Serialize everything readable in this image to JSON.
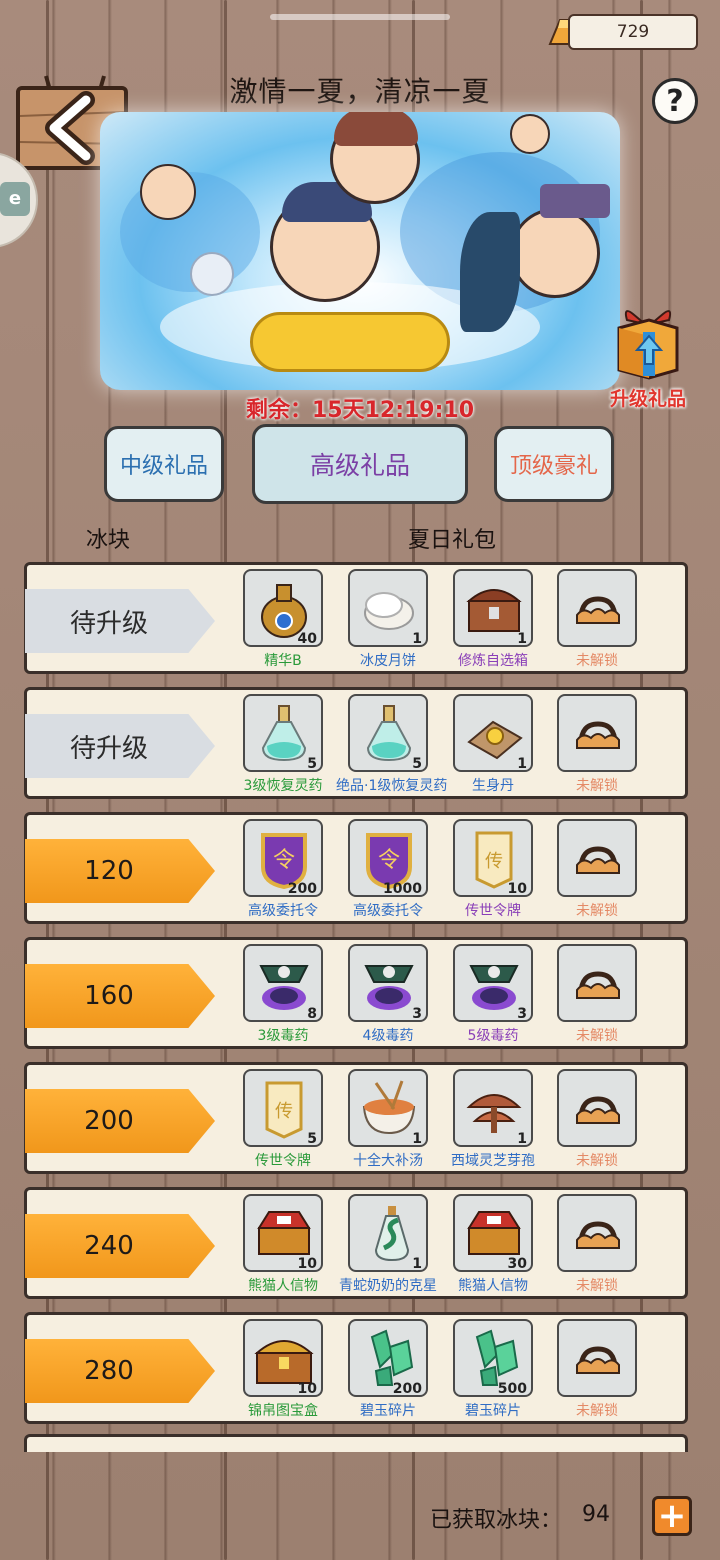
{
  "header": {
    "currency_value": "729",
    "title": "激情一夏，清凉一夏",
    "help_label": "?"
  },
  "countdown": "剩余：15天12:19:10",
  "upgrade_gift_label": "升级礼品",
  "tabs": [
    {
      "label": "中级礼品"
    },
    {
      "label": "高级礼品"
    },
    {
      "label": "顶级豪礼"
    }
  ],
  "columns": {
    "left": "冰块",
    "right": "夏日礼包"
  },
  "rows": [
    {
      "tag": "待升级",
      "items": [
        {
          "name": "精华B",
          "count": "40",
          "icon": "gourd-essence-icon",
          "color": "green"
        },
        {
          "name": "冰皮月饼",
          "count": "1",
          "icon": "mooncake-icon",
          "color": "blue"
        },
        {
          "name": "修炼自选箱",
          "count": "1",
          "icon": "treasure-chest-icon",
          "color": "purple"
        },
        {
          "name": "未解锁",
          "count": "",
          "icon": "lock-icon",
          "color": "lock"
        }
      ]
    },
    {
      "tag": "待升级",
      "items": [
        {
          "name": "3级恢复灵药",
          "count": "5",
          "icon": "potion-bottle-icon",
          "color": "green"
        },
        {
          "name": "绝品·1级恢复灵药",
          "count": "5",
          "icon": "potion-bottle-icon",
          "color": "blue"
        },
        {
          "name": "生身丹",
          "count": "1",
          "icon": "pill-icon",
          "color": "blue"
        },
        {
          "name": "未解锁",
          "count": "",
          "icon": "lock-icon",
          "color": "lock"
        }
      ]
    },
    {
      "tag": "120",
      "items": [
        {
          "name": "高级委托令",
          "count": "200",
          "icon": "purple-token-icon",
          "color": "blue"
        },
        {
          "name": "高级委托令",
          "count": "1000",
          "icon": "purple-token-icon",
          "color": "blue"
        },
        {
          "name": "传世令牌",
          "count": "10",
          "icon": "gold-plaque-icon",
          "color": "purple"
        },
        {
          "name": "未解锁",
          "count": "",
          "icon": "lock-icon",
          "color": "lock"
        }
      ]
    },
    {
      "tag": "160",
      "items": [
        {
          "name": "3级毒药",
          "count": "8",
          "icon": "poison-icon",
          "color": "green"
        },
        {
          "name": "4级毒药",
          "count": "3",
          "icon": "poison-icon",
          "color": "blue"
        },
        {
          "name": "5级毒药",
          "count": "3",
          "icon": "poison-icon",
          "color": "purple"
        },
        {
          "name": "未解锁",
          "count": "",
          "icon": "lock-icon",
          "color": "lock"
        }
      ]
    },
    {
      "tag": "200",
      "items": [
        {
          "name": "传世令牌",
          "count": "5",
          "icon": "gold-plaque-icon",
          "color": "green"
        },
        {
          "name": "十全大补汤",
          "count": "1",
          "icon": "soup-bowl-icon",
          "color": "blue"
        },
        {
          "name": "西域灵芝芽孢",
          "count": "1",
          "icon": "mushroom-icon",
          "color": "blue"
        },
        {
          "name": "未解锁",
          "count": "",
          "icon": "lock-icon",
          "color": "lock"
        }
      ]
    },
    {
      "tag": "240",
      "items": [
        {
          "name": "熊猫人信物",
          "count": "10",
          "icon": "red-chest-icon",
          "color": "green"
        },
        {
          "name": "青蛇奶奶的克星",
          "count": "1",
          "icon": "snake-bottle-icon",
          "color": "blue"
        },
        {
          "name": "熊猫人信物",
          "count": "30",
          "icon": "red-chest-icon",
          "color": "blue"
        },
        {
          "name": "未解锁",
          "count": "",
          "icon": "lock-icon",
          "color": "lock"
        }
      ]
    },
    {
      "tag": "280",
      "items": [
        {
          "name": "锦帛图宝盒",
          "count": "10",
          "icon": "gold-chest-icon",
          "color": "green"
        },
        {
          "name": "碧玉碎片",
          "count": "200",
          "icon": "jade-shard-icon",
          "color": "blue"
        },
        {
          "name": "碧玉碎片",
          "count": "500",
          "icon": "jade-shard-icon",
          "color": "blue"
        },
        {
          "name": "未解锁",
          "count": "",
          "icon": "lock-icon",
          "color": "lock"
        }
      ]
    }
  ],
  "footer": {
    "label": "已获取冰块：",
    "value": "94",
    "plus": "+"
  }
}
